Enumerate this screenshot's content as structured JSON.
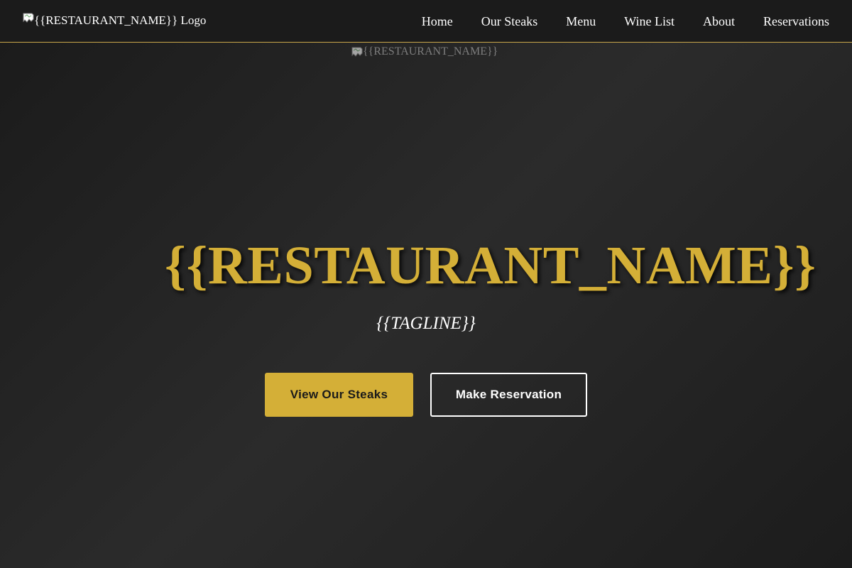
{
  "header": {
    "logo_alt": "{{RESTAURANT_NAME}} Logo",
    "nav": [
      {
        "label": "Home"
      },
      {
        "label": "Our Steaks"
      },
      {
        "label": "Menu"
      },
      {
        "label": "Wine List"
      },
      {
        "label": "About"
      },
      {
        "label": "Reservations"
      }
    ]
  },
  "hero": {
    "image_alt": "{{RESTAURANT_NAME}}",
    "title": "{{RESTAURANT_NAME}}",
    "tagline": "{{TAGLINE}}",
    "primary_button": "View Our Steaks",
    "secondary_button": "Make Reservation"
  },
  "colors": {
    "accent_gold": "#d4af37",
    "background": "#1e1e1e",
    "nav_border": "#c8a64a",
    "text": "#ffffff"
  },
  "icons": {
    "broken_image": "broken-image-icon"
  }
}
